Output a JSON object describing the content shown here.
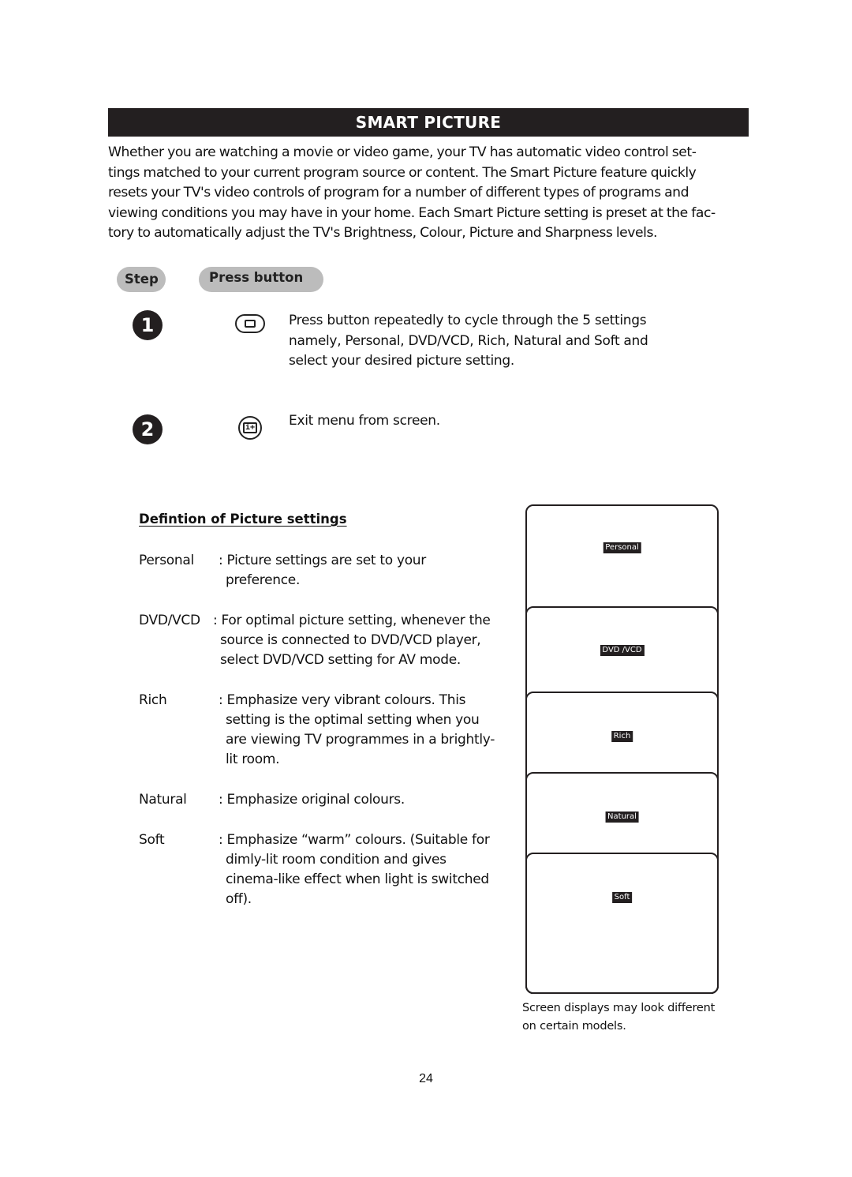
{
  "header": {
    "title": "SMART PICTURE"
  },
  "intro": {
    "lines": [
      "Whether you are watching a movie or video game, your TV has automatic video control set-",
      "tings matched to your current program source or content. The Smart Picture feature quickly",
      "resets your TV's video controls of program for a number of different types of programs and",
      "viewing conditions you may have in your home. Each Smart Picture setting is preset at the fac-",
      "tory to automatically adjust the TV's Brightness, Colour, Picture and Sharpness levels."
    ]
  },
  "table_header": {
    "step": "Step",
    "press_button": "Press button"
  },
  "steps": [
    {
      "number": "1",
      "icon": "smart-picture-button-icon",
      "lines": [
        "Press button repeatedly to cycle through the 5 settings",
        "namely, Personal, DVD/VCD, Rich, Natural and Soft and",
        "select your desired picture setting."
      ]
    },
    {
      "number": "2",
      "icon": "info-plus-button-icon",
      "icon_glyph": "i+",
      "lines": [
        "Exit menu from screen."
      ]
    }
  ],
  "definitions": {
    "heading": "Defintion of Picture settings",
    "items": [
      {
        "term": "Personal",
        "lines": [
          ": Picture settings are set to your",
          "preference."
        ]
      },
      {
        "term": "DVD/VCD",
        "lines": [
          ": For optimal picture setting, whenever the",
          "source is connected to DVD/VCD player,",
          "select DVD/VCD setting for AV mode."
        ]
      },
      {
        "term": "Rich",
        "lines": [
          ": Emphasize very vibrant colours. This",
          "setting is the optimal setting when you",
          "are viewing TV programmes in a brightly-",
          "lit room."
        ]
      },
      {
        "term": "Natural",
        "lines": [
          ": Emphasize original colours."
        ]
      },
      {
        "term": "Soft",
        "lines": [
          ": Emphasize “warm” colours. (Suitable for",
          "dimly-lit room condition and gives",
          "cinema-like effect when light is switched",
          "off)."
        ]
      }
    ]
  },
  "screens": [
    {
      "label": "Personal"
    },
    {
      "label": "DVD /VCD"
    },
    {
      "label": "Rich"
    },
    {
      "label": "Natural"
    },
    {
      "label": "Soft"
    }
  ],
  "caption": {
    "lines": [
      "Screen displays may look different",
      "on certain models."
    ]
  },
  "page_number": "24"
}
